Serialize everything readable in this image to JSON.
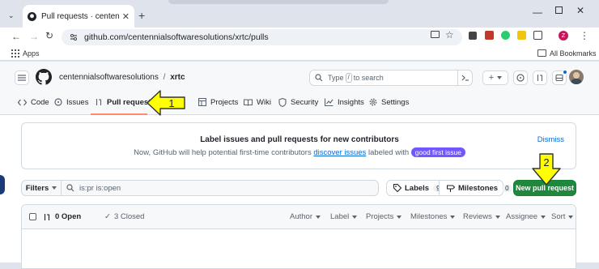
{
  "browser": {
    "tab_title": "Pull requests · centennialsoftw",
    "url": "github.com/centennialsoftwaresolutions/xrtc/pulls",
    "bookmarks_apps": "Apps",
    "bookmarks_all": "All Bookmarks",
    "profile_initial": "Z"
  },
  "repo": {
    "owner": "centennialsoftwaresolutions",
    "separator": "/",
    "name": "xrtc"
  },
  "search": {
    "text_before": "Type",
    "key": "/",
    "text_after": "to search"
  },
  "nav": {
    "code": "Code",
    "issues": "Issues",
    "pull_requests": "Pull requests",
    "actions": "ions",
    "projects": "Projects",
    "wiki": "Wiki",
    "security": "Security",
    "insights": "Insights",
    "settings": "Settings"
  },
  "banner": {
    "heading": "Label issues and pull requests for new contributors",
    "text_before": "Now, GitHub will help potential first-time contributors",
    "link": "discover issues",
    "text_middle": "labeled with",
    "badge": "good first issue",
    "dismiss": "Dismiss"
  },
  "filters": {
    "label": "Filters",
    "query": "is:pr is:open",
    "labels": "Labels",
    "labels_count": "9",
    "milestones": "Milestones",
    "milestones_count": "0",
    "new_pr": "New pull request"
  },
  "list": {
    "open": "0 Open",
    "closed": "3 Closed",
    "author": "Author",
    "label": "Label",
    "projects": "Projects",
    "milestones": "Milestones",
    "reviews": "Reviews",
    "assignee": "Assignee",
    "sort": "Sort"
  },
  "callouts": {
    "first": "1",
    "second": "2",
    "color": "#ffff00"
  }
}
